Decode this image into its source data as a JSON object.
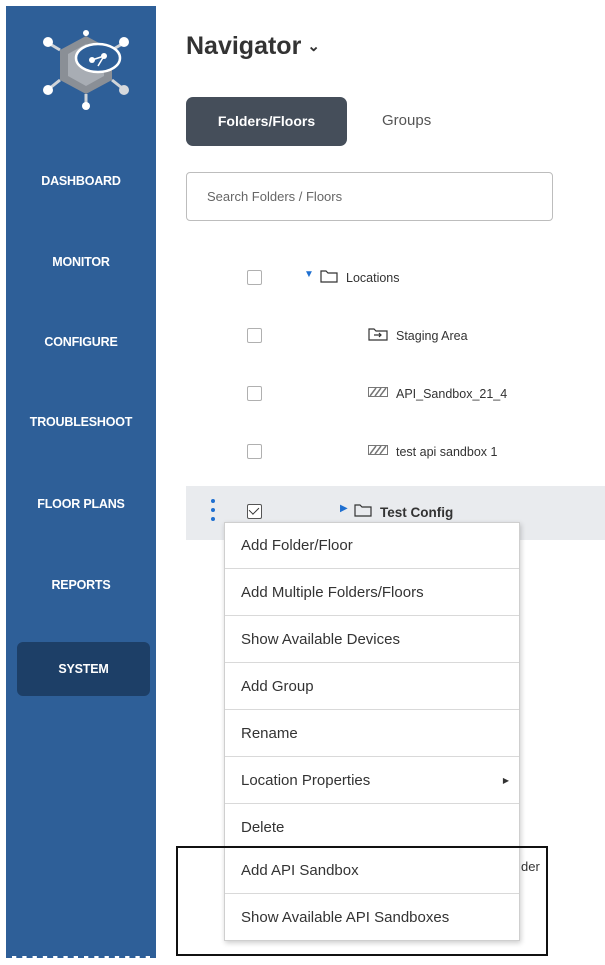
{
  "sidebar": {
    "items": [
      {
        "label": "DASHBOARD"
      },
      {
        "label": "MONITOR"
      },
      {
        "label": "CONFIGURE"
      },
      {
        "label": "TROUBLESHOOT"
      },
      {
        "label": "FLOOR PLANS"
      },
      {
        "label": "REPORTS"
      },
      {
        "label": "SYSTEM",
        "active": true
      }
    ],
    "color": "#2e5f98",
    "active_color": "#1d3f67"
  },
  "header": {
    "title": "Navigator",
    "title_chevron": "⌄"
  },
  "tabs": [
    {
      "label": "Folders/Floors",
      "active": true
    },
    {
      "label": "Groups",
      "active": false
    }
  ],
  "search": {
    "placeholder": "Search Folders / Floors"
  },
  "tree": [
    {
      "label": "Locations",
      "icon": "folder-icon",
      "expanded": true,
      "checked": false
    },
    {
      "label": "Staging Area",
      "icon": "staging-folder-icon",
      "checked": false
    },
    {
      "label": "API_Sandbox_21_4",
      "icon": "sandbox-icon",
      "checked": false
    },
    {
      "label": "test api sandbox 1",
      "icon": "sandbox-icon",
      "checked": false
    },
    {
      "label": "Test Config",
      "icon": "folder-icon",
      "expanded": false,
      "checked": true
    }
  ],
  "context_menu": {
    "items": [
      {
        "label": "Add Folder/Floor"
      },
      {
        "label": "Add Multiple Folders/Floors"
      },
      {
        "label": "Show Available Devices"
      },
      {
        "label": "Add Group"
      },
      {
        "label": "Rename"
      },
      {
        "label": "Location Properties",
        "submenu": true
      },
      {
        "label": "Delete"
      },
      {
        "label": "Add API Sandbox"
      },
      {
        "label": "Show Available API Sandboxes"
      }
    ]
  },
  "clipped_label": "der",
  "accent_color": "#1e6fd0"
}
